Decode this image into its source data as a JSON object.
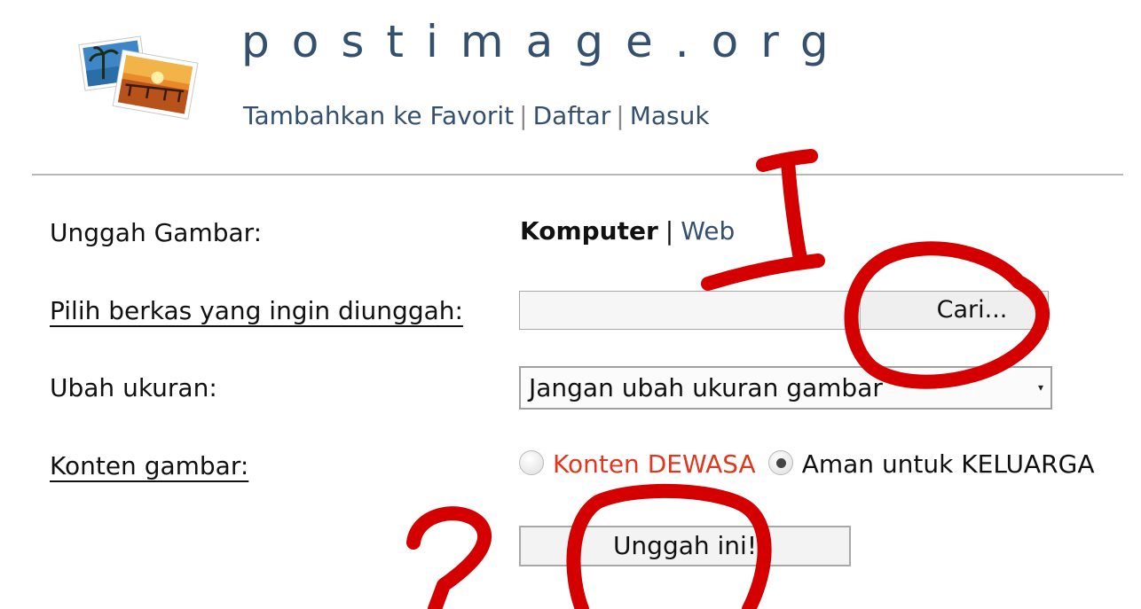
{
  "header": {
    "site_title": "postimage.org",
    "nav": {
      "favorite": "Tambahkan ke Favorit",
      "separator": "|",
      "register": "Daftar",
      "login": "Masuk"
    }
  },
  "form": {
    "upload_label": "Unggah Gambar:",
    "upload_mode": {
      "active": "Komputer",
      "separator": "|",
      "other": "Web"
    },
    "file_label": "Pilih berkas yang ingin diunggah:",
    "browse_button": "Cari...",
    "resize_label": "Ubah ukuran:",
    "resize_selected": "Jangan ubah ukuran gambar",
    "content_label": "Konten gambar:",
    "content_options": [
      {
        "label": "Konten DEWASA",
        "checked": false,
        "color": "#e0371e"
      },
      {
        "label": "Aman untuk KELUARGA",
        "checked": true,
        "color": "#111111"
      }
    ],
    "submit_button": "Unggah ini!"
  },
  "annotations": {
    "marker_1": "1",
    "marker_2": "2",
    "color": "#d40000"
  },
  "colors": {
    "brand": "#34506e",
    "adult": "#e0371e"
  }
}
